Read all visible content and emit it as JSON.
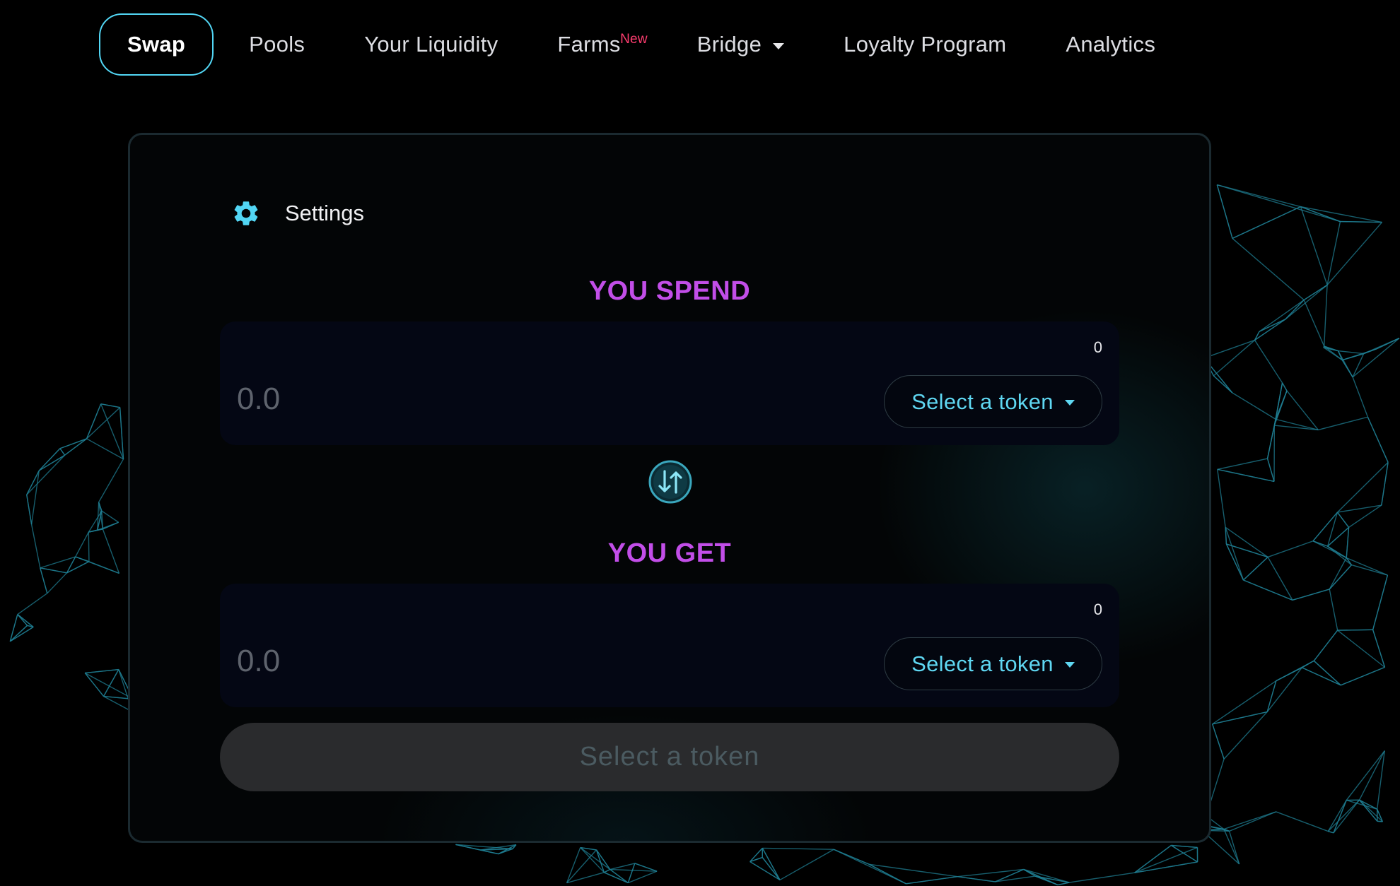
{
  "nav": {
    "items": [
      {
        "label": "Swap",
        "active": true
      },
      {
        "label": "Pools"
      },
      {
        "label": "Your Liquidity"
      },
      {
        "label": "Farms",
        "badge": "New"
      },
      {
        "label": "Bridge",
        "dropdown": true
      },
      {
        "label": "Loyalty Program"
      },
      {
        "label": "Analytics"
      }
    ]
  },
  "swap": {
    "settings_label": "Settings",
    "spend": {
      "title": "YOU SPEND",
      "balance": "0",
      "amount_placeholder": "0.0",
      "amount_value": "",
      "token_button": "Select a token"
    },
    "get": {
      "title": "YOU GET",
      "balance": "0",
      "amount_placeholder": "0.0",
      "amount_value": "",
      "token_button": "Select a token"
    },
    "submit_label": "Select a token",
    "submit_enabled": false
  },
  "colors": {
    "accent_cyan": "#52d6f4",
    "section_title": "#c24ee8",
    "badge_new": "#ff3d70",
    "background": "#000000"
  },
  "icons": {
    "settings": "gear-icon",
    "switch": "swap-arrows-icon",
    "dropdown": "caret-down-icon"
  }
}
